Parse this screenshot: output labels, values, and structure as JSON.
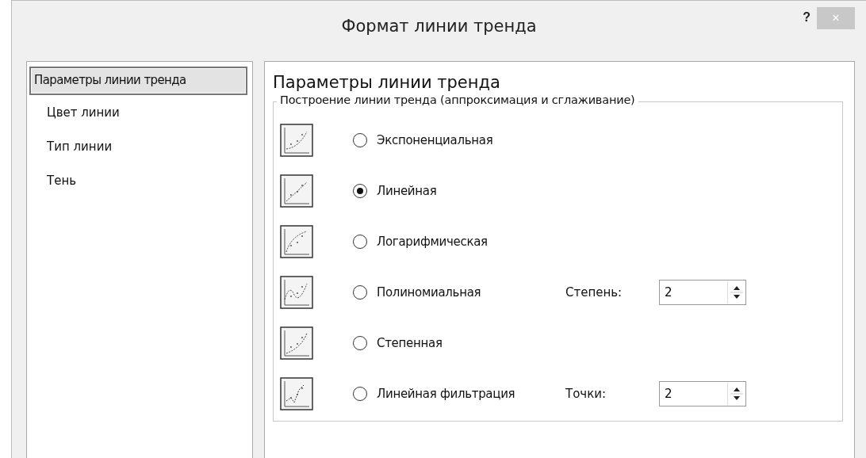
{
  "window": {
    "title": "Формат линии тренда",
    "help": "?",
    "close": "×"
  },
  "sidebar": {
    "items": [
      {
        "label": "Параметры линии тренда",
        "selected": true
      },
      {
        "label": "Цвет линии",
        "selected": false
      },
      {
        "label": "Тип линии",
        "selected": false
      },
      {
        "label": "Тень",
        "selected": false
      }
    ]
  },
  "panel": {
    "heading": "Параметры линии тренда",
    "group_title": "Построение линии тренда (аппроксимация и сглаживание)",
    "options": [
      {
        "kind": "exponential",
        "label": "Экспоненциальная",
        "selected": false
      },
      {
        "kind": "linear",
        "label": "Линейная",
        "selected": true
      },
      {
        "kind": "logarithmic",
        "label": "Логарифмическая",
        "selected": false
      },
      {
        "kind": "polynomial",
        "label": "Полиномиальная",
        "selected": false,
        "spinner": {
          "label": "Степень:",
          "value": "2"
        }
      },
      {
        "kind": "power",
        "label": "Степенная",
        "selected": false
      },
      {
        "kind": "moving",
        "label": "Линейная фильтрация",
        "selected": false,
        "spinner": {
          "label": "Точки:",
          "value": "2"
        }
      }
    ]
  }
}
